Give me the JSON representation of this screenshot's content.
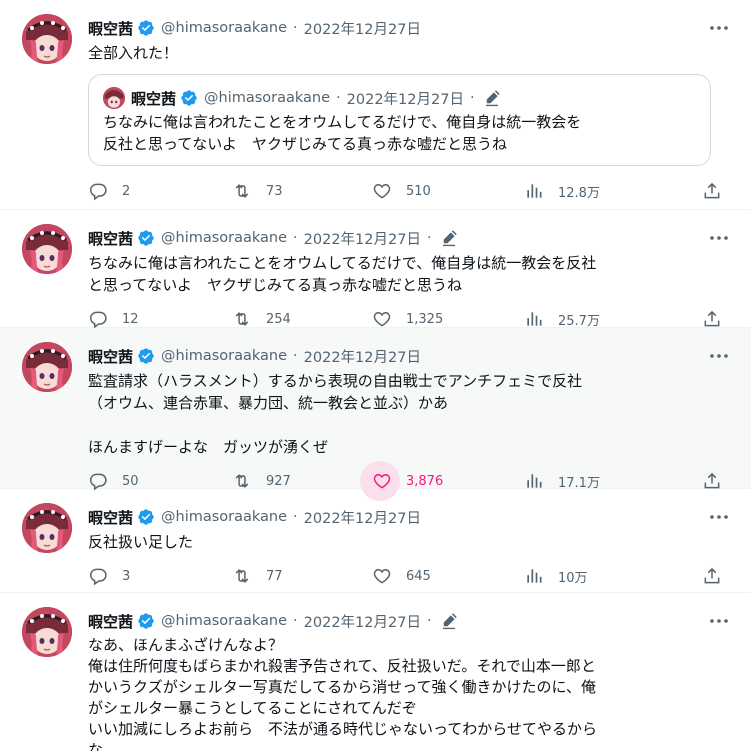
{
  "colors": {
    "accent": "#1d9bf0",
    "like": "#f91880",
    "muted": "#536471",
    "border": "#eff3f4"
  },
  "icons": {
    "verified": "verified-badge-icon",
    "edit": "edited-pencil-icon",
    "more": "more-dots-icon",
    "reply": "reply-bubble-icon",
    "retweet": "retweet-icon",
    "like": "heart-icon",
    "views": "views-bars-icon",
    "share": "share-upload-icon"
  },
  "tweets": [
    {
      "name": "暇空茜",
      "handle": "@himasoraakane",
      "date": "2022年12月27日",
      "edited": false,
      "text": "全部入れた！",
      "quote": {
        "name": "暇空茜",
        "handle": "@himasoraakane",
        "date": "2022年12月27日",
        "text": "ちなみに俺は言われたことをオウムしてるだけで、俺自身は統一教会を\n反社と思ってないよ　ヤクザじみてる真っ赤な嘘だと思うね"
      },
      "replies": "2",
      "retweets": "73",
      "likes": "510",
      "views": "12.8万",
      "liked": false
    },
    {
      "name": "暇空茜",
      "handle": "@himasoraakane",
      "date": "2022年12月27日",
      "edited": true,
      "text": "ちなみに俺は言われたことをオウムしてるだけで、俺自身は統一教会を反社\nと思ってないよ　ヤクザじみてる真っ赤な嘘だと思うね",
      "replies": "12",
      "retweets": "254",
      "likes": "1,325",
      "views": "25.7万",
      "liked": false
    },
    {
      "name": "暇空茜",
      "handle": "@himasoraakane",
      "date": "2022年12月27日",
      "edited": false,
      "text": "監査請求（ハラスメント）するから表現の自由戦士でアンチフェミで反社\n（オウム、連合赤軍、暴力団、統一教会と並ぶ）かあ\n\nほんますげーよな　ガッツが湧くぜ",
      "replies": "50",
      "retweets": "927",
      "likes": "3,876",
      "views": "17.1万",
      "liked": true
    },
    {
      "name": "暇空茜",
      "handle": "@himasoraakane",
      "date": "2022年12月27日",
      "edited": false,
      "text": "反社扱い足した",
      "replies": "3",
      "retweets": "77",
      "likes": "645",
      "views": "10万",
      "liked": false
    },
    {
      "name": "暇空茜",
      "handle": "@himasoraakane",
      "date": "2022年12月27日",
      "edited": true,
      "text": "なあ、ほんまふざけんなよ？\n俺は住所何度もばらまかれ殺害予告されて、反社扱いだ。それで山本一郎と\nかいうクズがシェルター写真だしてるから消せって強く働きかけたのに、俺\nがシェルター暴こうとしてることにされてんだぞ\nいい加減にしろよお前ら　不法が通る時代じゃないってわからせてやるから\nな"
    }
  ]
}
